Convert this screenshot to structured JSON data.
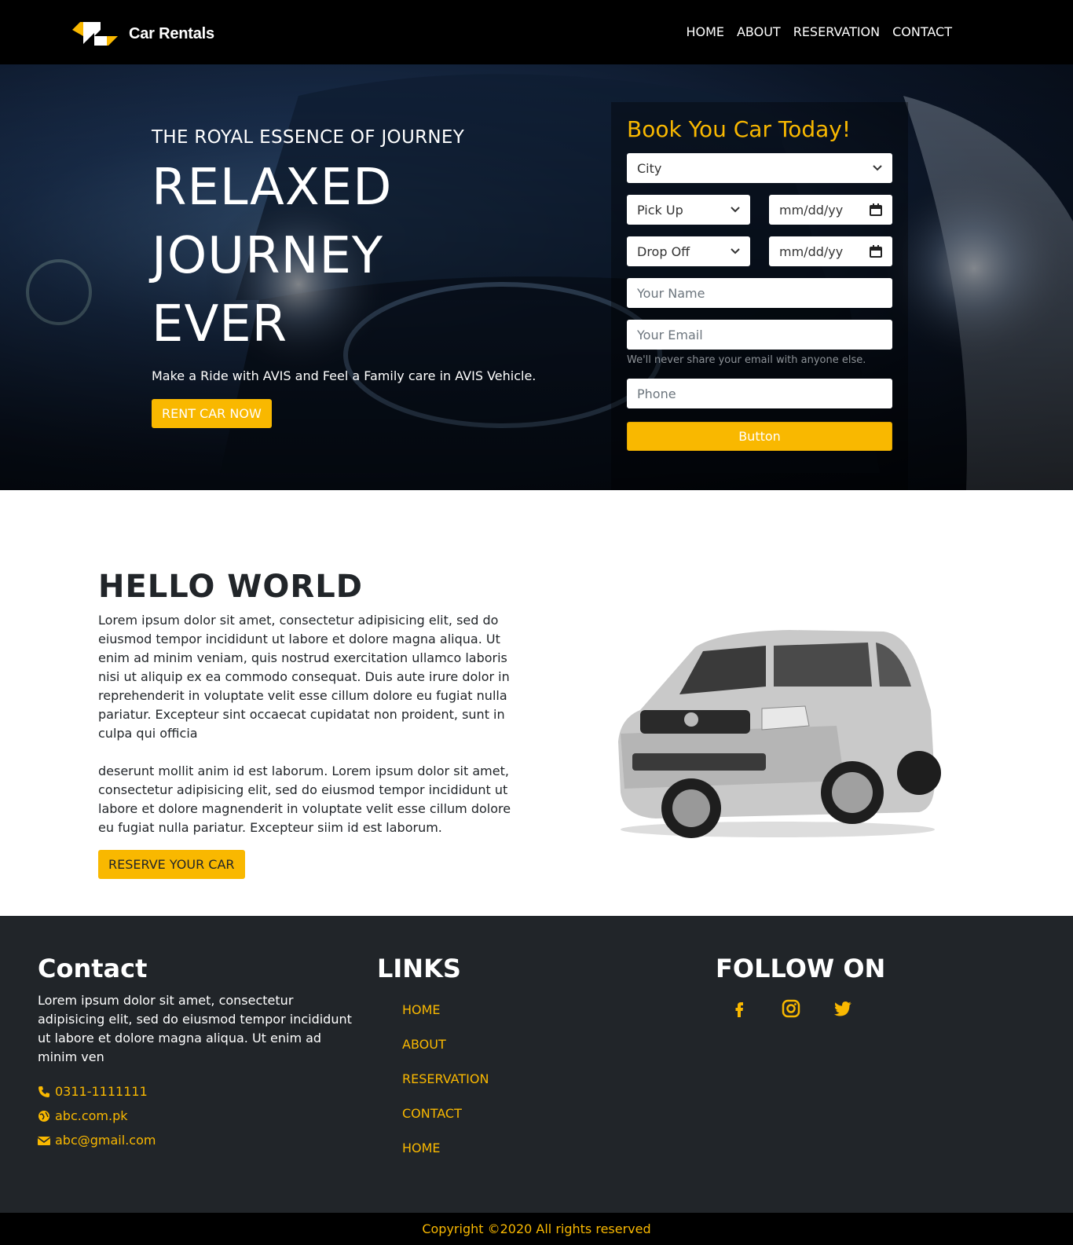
{
  "nav": {
    "brand": "Car Rentals",
    "links": [
      "HOME",
      "ABOUT",
      "RESERVATION",
      "CONTACT"
    ]
  },
  "hero": {
    "subtitle": "THE ROYAL ESSENCE OF JOURNEY",
    "title_lines": [
      "RELAXED",
      "JOURNEY",
      "EVER"
    ],
    "description": "Make a Ride with AVIS and Feel a Family care in AVIS Vehicle.",
    "cta": "RENT CAR NOW"
  },
  "booking": {
    "title": "Book You Car Today!",
    "city": "City",
    "pickup": "Pick Up",
    "pickup_date": "mm/dd/yy",
    "dropoff": "Drop Off",
    "dropoff_date": "mm/dd/yy",
    "name_placeholder": "Your Name",
    "email_placeholder": "Your Email",
    "email_hint": "We'll never share your email with anyone else.",
    "phone_placeholder": "Phone",
    "submit": "Button"
  },
  "about": {
    "title": "HELLO WORLD",
    "paragraph1": "Lorem ipsum dolor sit amet, consectetur adipisicing elit, sed do eiusmod tempor incididunt ut labore et dolore magna aliqua. Ut enim ad minim veniam, quis nostrud exercitation ullamco laboris nisi ut aliquip ex ea commodo consequat. Duis aute irure dolor in reprehenderit in voluptate velit esse cillum dolore eu fugiat nulla pariatur. Excepteur sint occaecat cupidatat non proident, sunt in culpa qui officia",
    "paragraph2": "deserunt mollit anim id est laborum. Lorem ipsum dolor sit amet, consectetur adipisicing elit, sed do eiusmod tempor incididunt ut labore et dolore magnenderit in voluptate velit esse cillum dolore eu fugiat nulla pariatur. Excepteur siim id est laborum.",
    "cta": "RESERVE YOUR CAR"
  },
  "footer": {
    "contact_title": "Contact",
    "contact_text": "Lorem ipsum dolor sit amet, consectetur adipisicing elit, sed do eiusmod tempor incididunt ut labore et dolore magna aliqua. Ut enim ad minim ven",
    "phone": "0311-1111111",
    "website": "abc.com.pk",
    "email": "abc@gmail.com",
    "links_title": "LINKS",
    "links": [
      "HOME",
      "ABOUT",
      "RESERVATION",
      "CONTACT",
      "HOME"
    ],
    "follow_title": "FOLLOW ON",
    "socials": [
      "facebook-icon",
      "instagram-icon",
      "twitter-icon"
    ]
  },
  "copyright": "Copyright ©2020 All rights reserved",
  "colors": {
    "accent": "#f9b800",
    "nav_bg": "#000000",
    "footer_bg": "#212529"
  }
}
